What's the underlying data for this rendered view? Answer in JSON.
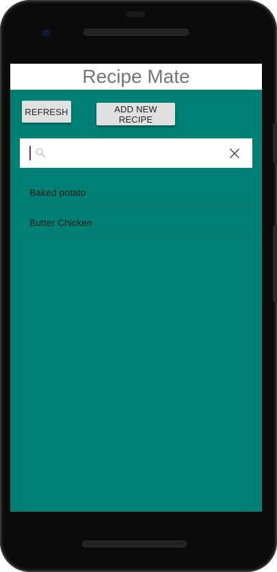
{
  "app": {
    "title": "Recipe Mate"
  },
  "toolbar": {
    "refresh_label": "REFRESH",
    "add_label": "ADD NEW RECIPE"
  },
  "search": {
    "value": "",
    "placeholder": "",
    "search_icon": "search-icon",
    "clear_icon": "close-icon"
  },
  "recipes": [
    {
      "name": "Baked potato"
    },
    {
      "name": "Butter Chicken"
    }
  ],
  "colors": {
    "background": "#008074",
    "header": "#ffffff",
    "button": "#e0e0e0",
    "cursor": "#8e1f6e"
  }
}
